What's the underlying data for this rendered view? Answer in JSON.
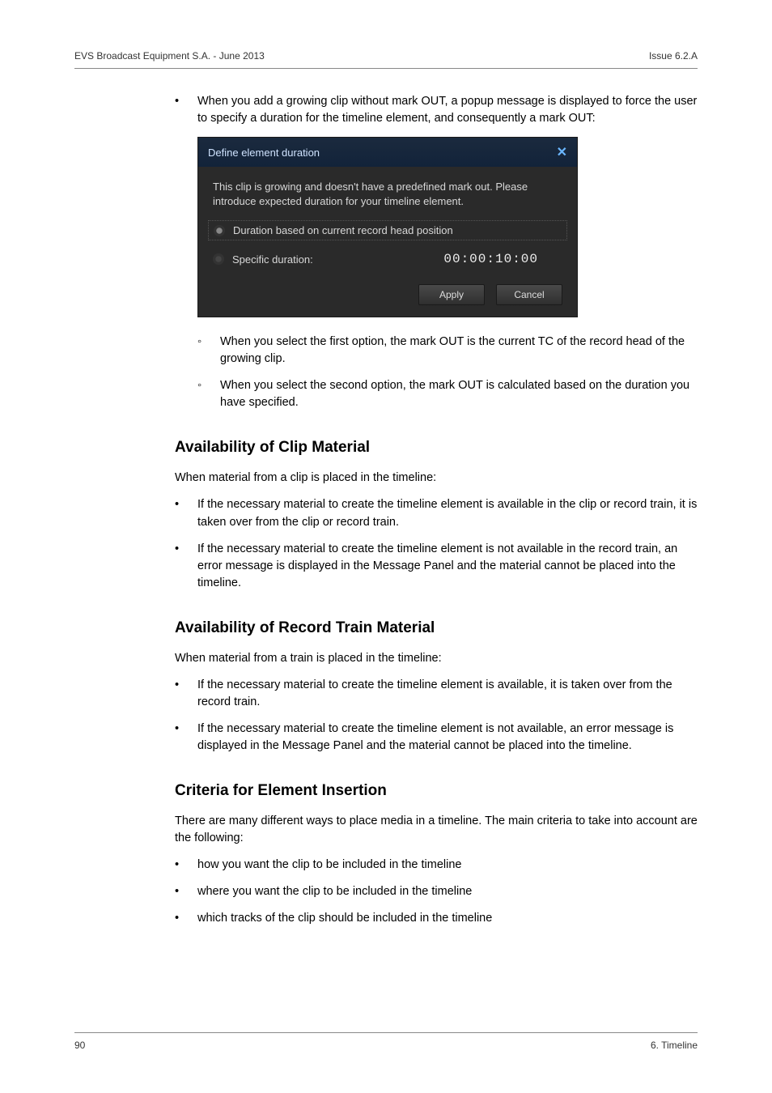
{
  "header": {
    "left": "EVS Broadcast Equipment S.A. - June 2013",
    "right": "Issue 6.2.A"
  },
  "intro_bullet": "When you add a growing clip without mark OUT, a popup message is displayed to force the user to specify a duration for the timeline element, and consequently a mark OUT:",
  "dialog": {
    "title": "Define element duration",
    "message": "This clip is growing and doesn't have a predefined mark out. Please introduce expected duration for your timeline element.",
    "opt1": "Duration based on current record head position",
    "opt2": "Specific duration:",
    "value": "00:00:10:00",
    "apply": "Apply",
    "cancel": "Cancel"
  },
  "sub1": "When you select the first option, the mark OUT is the current TC of the record head of the growing clip.",
  "sub2": "When you select the second option, the mark OUT is calculated based on the duration you have specified.",
  "h1": "Availability of Clip Material",
  "p1": "When material from a clip is placed in the timeline:",
  "b1a": "If the necessary material to create the timeline element is available in the clip or record train, it is taken over from the clip or record train.",
  "b1b": "If the necessary material to create the timeline element is not available in the record train, an error message is displayed in the Message Panel and the material cannot be placed into the timeline.",
  "h2": "Availability of Record Train Material",
  "p2": "When material from a train is placed in the timeline:",
  "b2a": "If the necessary material to create the timeline element is available, it is taken over from the record train.",
  "b2b": "If the necessary material to create the timeline element is not available, an error message is displayed in the Message Panel and the material cannot be placed into the timeline.",
  "h3": "Criteria for Element Insertion",
  "p3": "There are many different ways to place media in a timeline. The main criteria to take into account are the following:",
  "b3a": "how you want the clip to be included in the timeline",
  "b3b": "where you want the clip to be included in the timeline",
  "b3c": "which tracks of the clip should be included in the timeline",
  "footer": {
    "left": "90",
    "right": "6. Timeline"
  }
}
